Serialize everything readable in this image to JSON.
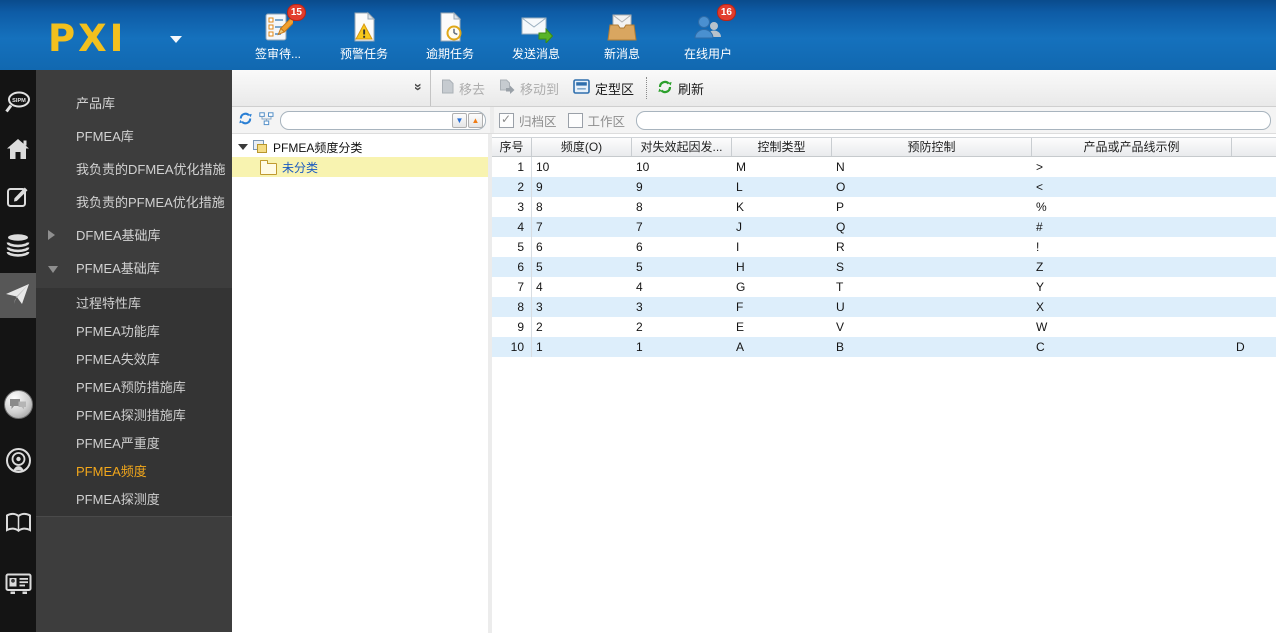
{
  "header": {
    "logo": "PXI",
    "tools": [
      {
        "icon": "sign-review-checklist-icon",
        "label": "签审待...",
        "badge": "15"
      },
      {
        "icon": "warning-task-icon",
        "label": "预警任务"
      },
      {
        "icon": "overdue-task-icon",
        "label": "逾期任务"
      },
      {
        "icon": "send-message-icon",
        "label": "发送消息"
      },
      {
        "icon": "new-message-icon",
        "label": "新消息"
      },
      {
        "icon": "online-users-icon",
        "label": "在线用户",
        "badge": "16"
      }
    ]
  },
  "rail": {
    "items": [
      "sipm-search-icon",
      "home-icon",
      "edit-icon",
      "database-icon",
      "send-plane-icon",
      "chat-icon",
      "broadcast-icon",
      "book-icon",
      "contact-card-icon"
    ],
    "selected": "send-plane-icon"
  },
  "sidebar": {
    "items": [
      {
        "label": "产品库"
      },
      {
        "label": "PFMEA库"
      },
      {
        "label": "我负责的DFMEA优化措施"
      },
      {
        "label": "我负责的PFMEA优化措施"
      },
      {
        "label": "DFMEA基础库",
        "expandable": true,
        "expanded": false
      },
      {
        "label": "PFMEA基础库",
        "expandable": true,
        "expanded": true
      }
    ],
    "subitems": [
      {
        "label": "过程特性库"
      },
      {
        "label": "PFMEA功能库"
      },
      {
        "label": "PFMEA失效库"
      },
      {
        "label": "PFMEA预防措施库"
      },
      {
        "label": "PFMEA探测措施库"
      },
      {
        "label": "PFMEA严重度"
      },
      {
        "label": "PFMEA频度",
        "selected": true
      },
      {
        "label": "PFMEA探测度"
      }
    ]
  },
  "toolbar": {
    "remove_label": "移去",
    "move_to_label": "移动到",
    "finalize_label": "定型区",
    "refresh_label": "刷新",
    "combo_value": ""
  },
  "filter_bar": {
    "archive_label": "归档区",
    "archive_checked": true,
    "work_label": "工作区",
    "work_checked": false,
    "search_value": ""
  },
  "tree": {
    "search_value": "",
    "root_label": "PFMEA频度分类",
    "child_label": "未分类"
  },
  "table": {
    "columns": [
      "序号",
      "频度(O)",
      "对失效起因发...",
      "控制类型",
      "预防控制",
      "产品或产品线示例",
      ""
    ],
    "rows": [
      [
        "1",
        "10",
        "10",
        "M",
        "N",
        ">",
        ""
      ],
      [
        "2",
        "9",
        "9",
        "L",
        "O",
        "<",
        ""
      ],
      [
        "3",
        "8",
        "8",
        "K",
        "P",
        "%",
        ""
      ],
      [
        "4",
        "7",
        "7",
        "J",
        "Q",
        "#",
        ""
      ],
      [
        "5",
        "6",
        "6",
        "I",
        "R",
        "!",
        ""
      ],
      [
        "6",
        "5",
        "5",
        "H",
        "S",
        "Z",
        ""
      ],
      [
        "7",
        "4",
        "4",
        "G",
        "T",
        "Y",
        ""
      ],
      [
        "8",
        "3",
        "3",
        "F",
        "U",
        "X",
        ""
      ],
      [
        "9",
        "2",
        "2",
        "E",
        "V",
        "W",
        ""
      ],
      [
        "10",
        "1",
        "1",
        "A",
        "B",
        "C",
        "D"
      ]
    ]
  },
  "colors": {
    "topbar_blue": "#1571bd",
    "logo_yellow": "#f2c01e",
    "badge_red": "#e23c2c",
    "rail_black": "#141414",
    "sidebar_gray": "#3d3d3d",
    "submenu_gray": "#343434",
    "selected_orange": "#f2a71b",
    "tree_selected_yellow": "#f8f3b0",
    "tree_link_blue": "#1a5ac0",
    "row_alt_blue": "#ddeefb",
    "refresh_green": "#2ca02c",
    "refresh_blue": "#2a7fd4"
  }
}
